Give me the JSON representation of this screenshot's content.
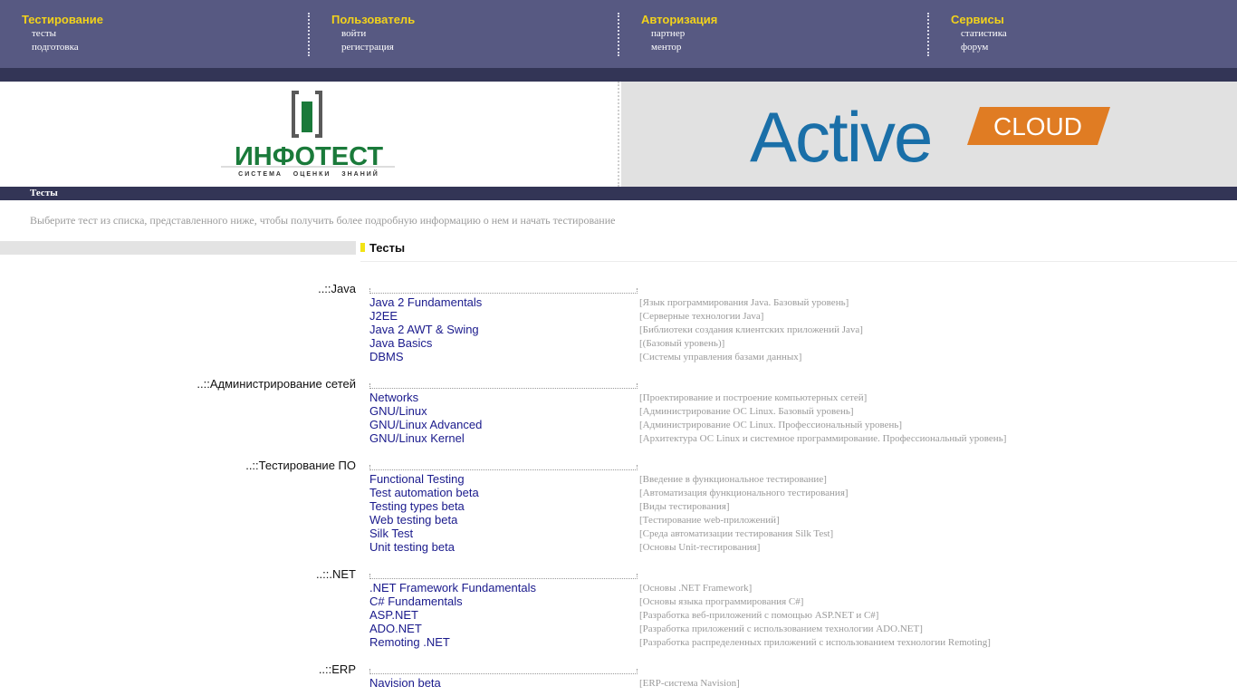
{
  "nav": [
    {
      "title": "Тестирование",
      "links": [
        "тесты",
        "подготовка"
      ]
    },
    {
      "title": "Пользователь",
      "links": [
        "войти",
        "регистрация"
      ]
    },
    {
      "title": "Авторизация",
      "links": [
        "партнер",
        "ментор"
      ]
    },
    {
      "title": "Сервисы",
      "links": [
        "статистика",
        "форум"
      ]
    }
  ],
  "banner": {
    "logo_left_text": "ИНФОТЕСТ",
    "logo_left_sub": "СИСТЕМА   ОЦЕНКИ   ЗНАНИЙ",
    "logo_right_text": "Active",
    "logo_right_badge": "CLOUD",
    "colors": {
      "infotest_green": "#1a7a3a",
      "infotest_gray": "#5a5a5a",
      "active_blue": "#1a6fa8",
      "active_orange": "#e07c23"
    }
  },
  "section_title": "Тесты",
  "intro": "Выберите тест из списка, представленного ниже, чтобы получить более подробную информацию о нем и начать тестирование",
  "list_title": "Тесты",
  "categories": [
    {
      "name": "..::Java",
      "tests": [
        {
          "name": "Java 2 Fundamentals",
          "desc": "[Язык программирования Java. Базовый уровень]"
        },
        {
          "name": "J2EE",
          "desc": "[Серверные технологии Java]"
        },
        {
          "name": "Java 2 AWT & Swing",
          "desc": "[Библиотеки создания клиентских приложений Java]"
        },
        {
          "name": "Java Basics",
          "desc": "[(Базовый уровень)]"
        },
        {
          "name": "DBMS",
          "desc": "[Системы управления базами данных]"
        }
      ]
    },
    {
      "name": "..::Администрирование сетей",
      "tests": [
        {
          "name": "Networks",
          "desc": "[Проектирование и построение компьютерных сетей]"
        },
        {
          "name": "GNU/Linux",
          "desc": "[Администрирование ОС Linux. Базовый уровень]"
        },
        {
          "name": "GNU/Linux Advanced",
          "desc": "[Администрирование ОС Linux. Профессиональный уровень]"
        },
        {
          "name": "GNU/Linux Kernel",
          "desc": "[Архитектура ОС Linux и системное программирование. Профессиональный уровень]"
        }
      ]
    },
    {
      "name": "..::Тестирование ПО",
      "tests": [
        {
          "name": "Functional Testing",
          "desc": "[Введение в функциональное тестирование]"
        },
        {
          "name": "Test automation beta",
          "desc": "[Автоматизация функционального тестирования]"
        },
        {
          "name": "Testing types beta",
          "desc": "[Виды тестирования]"
        },
        {
          "name": "Web testing beta",
          "desc": "[Тестирование web-приложений]"
        },
        {
          "name": "Silk Test",
          "desc": "[Среда автоматизации тестирования Silk Test]"
        },
        {
          "name": "Unit testing beta",
          "desc": "[Основы Unit-тестирования]"
        }
      ]
    },
    {
      "name": "..::.NET",
      "tests": [
        {
          "name": ".NET Framework Fundamentals",
          "desc": "[Основы .NET Framework]"
        },
        {
          "name": "C# Fundamentals",
          "desc": "[Основы языка программирования C#]"
        },
        {
          "name": "ASP.NET",
          "desc": "[Разработка веб-приложений с помощью ASP.NET и C#]"
        },
        {
          "name": "ADO.NET",
          "desc": "[Разработка приложений с использованием технологии ADO.NET]"
        },
        {
          "name": "Remoting .NET",
          "desc": "[Разработка распределенных приложений с использованием технологии Remoting]"
        }
      ]
    },
    {
      "name": "..::ERP",
      "tests": [
        {
          "name": "Navision beta",
          "desc": "[ERP-система Navision]"
        }
      ]
    }
  ]
}
